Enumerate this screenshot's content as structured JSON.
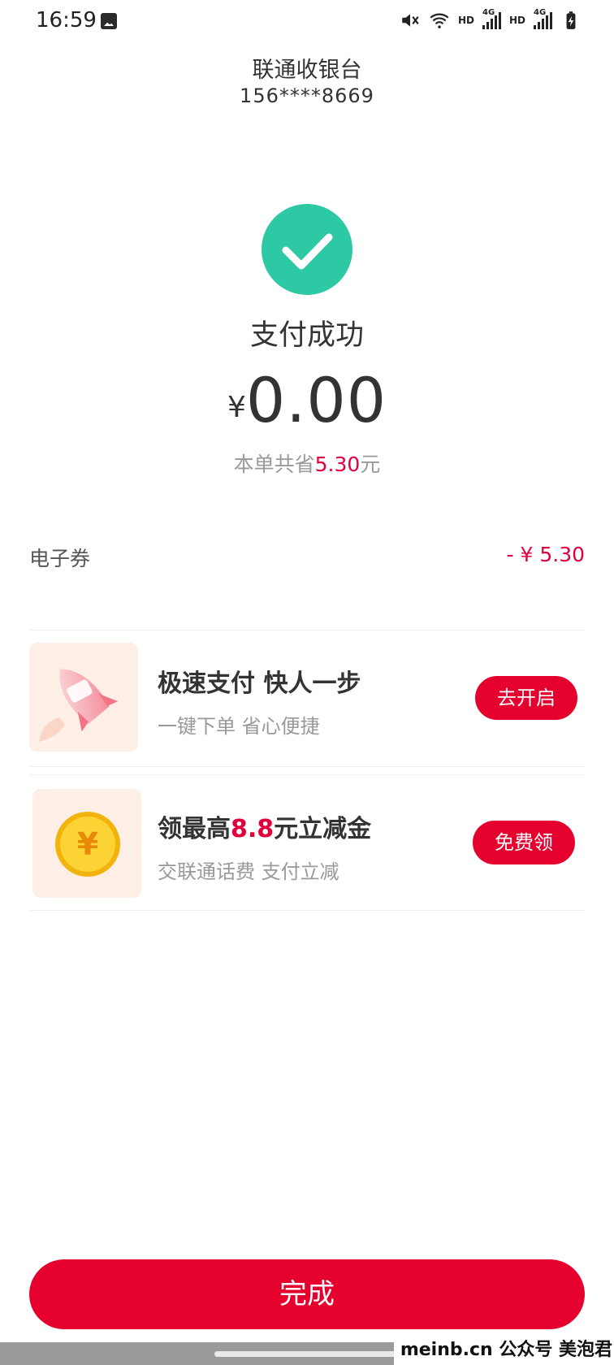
{
  "status_bar": {
    "time": "16:59",
    "network_label_1": "HD",
    "network_type_1": "4G",
    "network_label_2": "HD",
    "network_type_2": "4G",
    "icons": [
      "photo-icon",
      "mute-icon",
      "wifi-icon",
      "signal-icon",
      "signal-icon",
      "battery-charging-icon"
    ]
  },
  "header": {
    "title": "联通收银台",
    "phone": "156****8669"
  },
  "result": {
    "status_text": "支付成功",
    "currency_symbol": "¥",
    "amount": "0.00",
    "saved_prefix": "本单共省",
    "saved_amount": "5.30",
    "saved_suffix": "元",
    "check_color": "#2dc9a4"
  },
  "coupon": {
    "label": "电子券",
    "value": "- ¥ 5.30"
  },
  "promos": [
    {
      "title": "极速支付 快人一步",
      "subtitle": "一键下单 省心便捷",
      "button": "去开启",
      "icon": "rocket-icon"
    },
    {
      "title_prefix": "领最高",
      "title_highlight": "8.8",
      "title_suffix": "元立减金",
      "subtitle": "交联通话费 支付立减",
      "button": "免费领",
      "icon": "coin-icon",
      "coin_symbol": "¥"
    }
  ],
  "footer": {
    "done_button": "完成",
    "watermark": "meinb.cn  公众号 美泡君"
  },
  "colors": {
    "accent": "#e6002d",
    "highlight_text": "#e1003c",
    "success": "#2dc9a4"
  }
}
